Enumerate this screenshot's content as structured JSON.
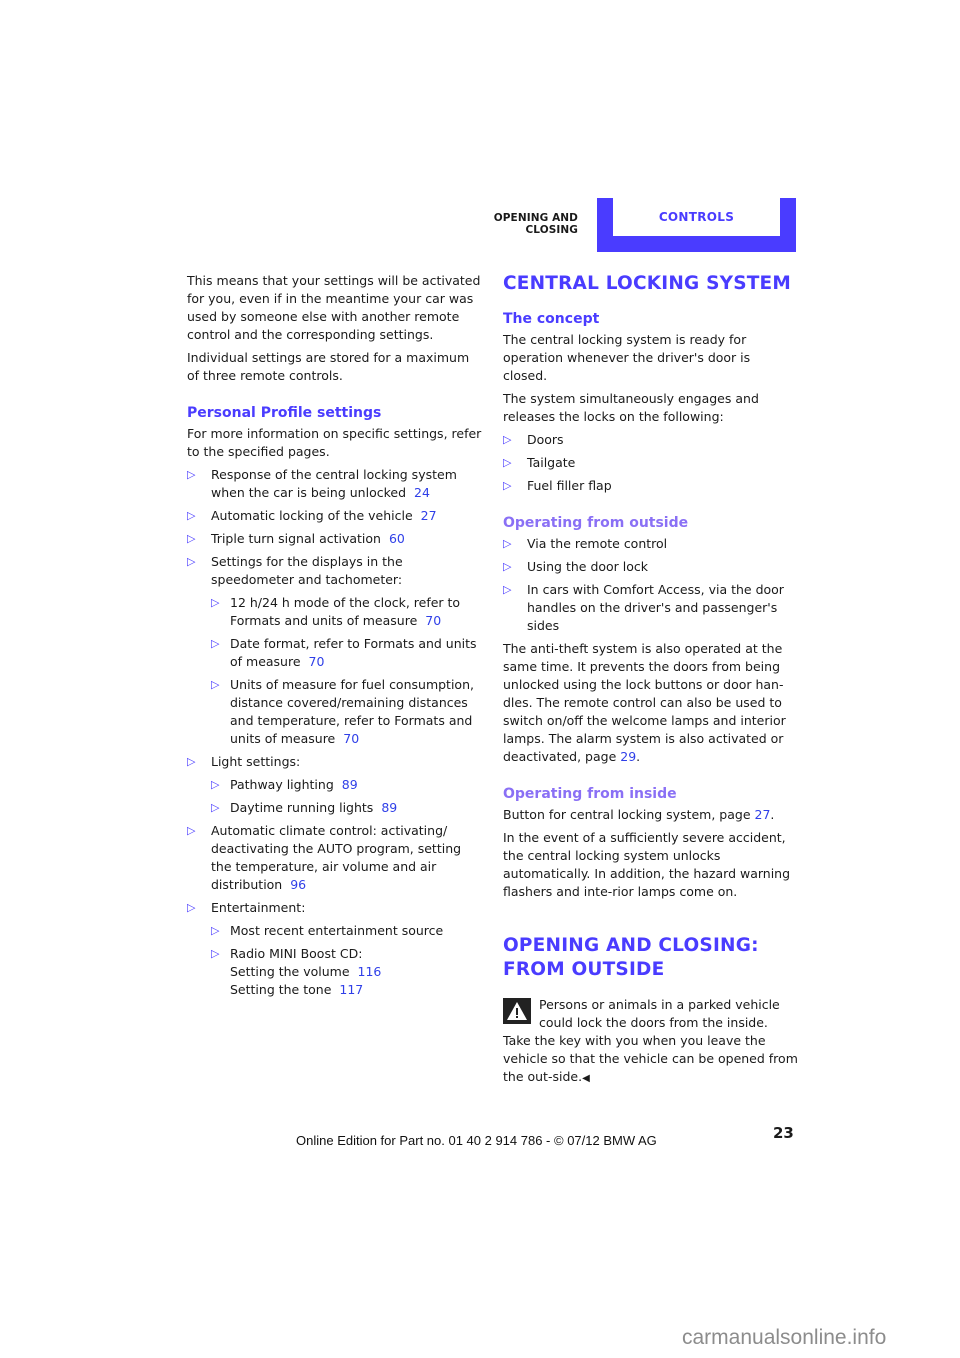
{
  "header": {
    "section": "OPENING AND CLOSING",
    "chapter_tab": "CONTROLS",
    "accent_color": "#4a3cff"
  },
  "left": {
    "intro_p1": "This means that your settings will be activated for you, even if in the meantime your car was used by someone else with another remote control and the corresponding settings.",
    "intro_p2": "Individual settings are stored for a maximum of three remote controls.",
    "profile_heading": "Personal Profile settings",
    "profile_intro": "For more information on specific settings, refer to the specified pages.",
    "items": [
      {
        "text": "Response of the central locking system when the car is being unlocked",
        "page": "24"
      },
      {
        "text": "Automatic locking of the vehicle",
        "page": "27"
      },
      {
        "text": "Triple turn signal activation",
        "page": "60"
      },
      {
        "text": "Settings for the displays in the speedometer and tachometer:",
        "sub": [
          {
            "text": "12 h/24 h mode of the clock, refer to Formats and units of measure",
            "page": "70"
          },
          {
            "text": "Date format, refer to Formats and units of measure",
            "page": "70"
          },
          {
            "text": "Units of measure for fuel consumption, distance covered/remaining distances and temperature, refer to Formats and units of measure",
            "page": "70"
          }
        ]
      },
      {
        "text": "Light settings:",
        "sub": [
          {
            "text": "Pathway lighting",
            "page": "89"
          },
          {
            "text": "Daytime running lights",
            "page": "89"
          }
        ]
      },
      {
        "text": "Automatic climate control: activating/ deactivating the AUTO program, setting the temperature, air volume and air distribution",
        "page": "96"
      },
      {
        "text": "Entertainment:",
        "sub": [
          {
            "text": "Most recent entertainment source"
          },
          {
            "text": "Radio MINI Boost CD:",
            "line2": "Setting the volume",
            "page2": "116",
            "line3": "Setting the tone",
            "page3": "117"
          }
        ]
      }
    ]
  },
  "right": {
    "central_heading": "CENTRAL LOCKING SYSTEM",
    "concept_heading": "The concept",
    "concept_p1": "The central locking system is ready for operation whenever the driver's door is closed.",
    "concept_p2": "The system simultaneously engages and releases the locks on the following:",
    "locks": [
      "Doors",
      "Tailgate",
      "Fuel filler flap"
    ],
    "outside_heading": "Operating from outside",
    "outside_items": [
      "Via the remote control",
      "Using the door lock",
      "In cars with Comfort Access, via the door handles on the driver's and passenger's sides"
    ],
    "antitheft_text": "The anti-theft system is also operated at the same time. It prevents the doors from being unlocked using the lock buttons or door han-dles. The remote control can also be used to switch on/off the welcome lamps and interior lamps. The alarm system is also activated or deactivated, page",
    "antitheft_page": "29",
    "inside_heading": "Operating from inside",
    "inside_p1_text": "Button for central locking system, page",
    "inside_p1_page": "27",
    "inside_p2": "In the event of a sufficiently severe accident, the central locking system unlocks automatically. In addition, the hazard warning flashers and inte-rior lamps come on.",
    "outside_open_heading_l1": "OPENING AND CLOSING:",
    "outside_open_heading_l2": "FROM OUTSIDE",
    "warning_text": "Persons or animals in a parked vehicle could lock the doors from the inside. Take the key with you when you leave the vehicle so that the vehicle can be opened from the out-side.",
    "warning_end": "◀"
  },
  "footer": {
    "page_number": "23",
    "edition": "Online Edition for Part no. 01 40 2 914 786 - © 07/12 BMW AG",
    "watermark": "carmanualsonline.info"
  }
}
